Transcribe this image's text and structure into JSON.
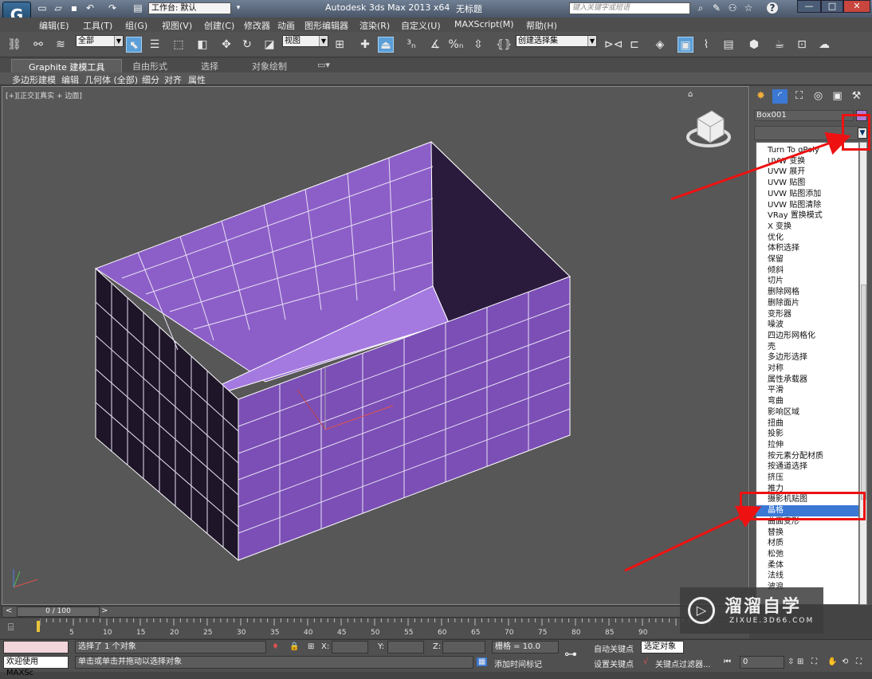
{
  "titlebar": {
    "logo": "G",
    "workspace": "工作台: 默认",
    "app_title": "Autodesk 3ds Max  2013 x64",
    "doc_name": "无标题",
    "search_placeholder": "键入关键字或短语",
    "help_label": "?",
    "minimize": "—",
    "maximize": "□",
    "close": "✕"
  },
  "menubar": {
    "items": [
      "编辑(E)",
      "工具(T)",
      "组(G)",
      "视图(V)",
      "创建(C)",
      "修改器",
      "动画",
      "图形编辑器",
      "渲染(R)",
      "自定义(U)",
      "MAXScript(M)",
      "帮助(H)"
    ]
  },
  "maintoolbar": {
    "filter": "全部",
    "ref_coord": "视图",
    "selection_set": "创建选择集"
  },
  "ribbon": {
    "tabs": [
      "Graphite 建模工具",
      "自由形式",
      "选择",
      "对象绘制"
    ],
    "subtabs": [
      "多边形建模",
      "编辑",
      "几何体 (全部)",
      "细分",
      "对齐",
      "属性"
    ]
  },
  "viewport": {
    "label": "[+][正交][真实 + 边面]",
    "box_color": "#8c5fc8"
  },
  "cmdpanel": {
    "object_name": "Box001",
    "object_color": "#b07ad8",
    "modifier_list": [
      "Turn To gPoly",
      "UVW 变换",
      "UVW 展开",
      "UVW 贴图",
      "UVW 贴图添加",
      "UVW 贴图清除",
      "VRay 置换模式",
      "X 变换",
      "优化",
      "体积选择",
      "保留",
      "倾斜",
      "切片",
      "删除网格",
      "删除面片",
      "变形器",
      "噪波",
      "四边形网格化",
      "壳",
      "多边形选择",
      "对称",
      "属性承载器",
      "平滑",
      "弯曲",
      "影响区域",
      "扭曲",
      "投影",
      "拉伸",
      "按元素分配材质",
      "按通道选择",
      "挤压",
      "推力",
      "摄影机贴图",
      "晶格",
      "曲面变形",
      "替换",
      "材质",
      "松弛",
      "柔体",
      "法线",
      "波浪"
    ],
    "selected_modifier": "晶格"
  },
  "timeslider": {
    "frame": "0 / 100",
    "prev": "<",
    "next": ">"
  },
  "trackbar": {
    "ticks": [
      "5",
      "10",
      "15",
      "20",
      "25",
      "30",
      "35",
      "40",
      "45",
      "50",
      "55",
      "60",
      "65",
      "70",
      "75",
      "80",
      "85",
      "90"
    ]
  },
  "statusbar": {
    "welcome": "欢迎使用 MAXSc",
    "selection_status": "选择了 1 个对象",
    "prompt": "单击或单击并拖动以选择对象",
    "x_label": "X:",
    "y_label": "Y:",
    "z_label": "Z:",
    "grid": "栅格 = 10.0",
    "add_time_tag": "添加时间标记",
    "auto_key": "自动关键点",
    "selected_object": "选定对象",
    "set_key": "设置关键点",
    "key_filters": "关键点过滤器...",
    "frame_value": "0"
  },
  "watermark": {
    "title": "溜溜自学",
    "subtitle": "ZIXUE.3D66.COM"
  }
}
